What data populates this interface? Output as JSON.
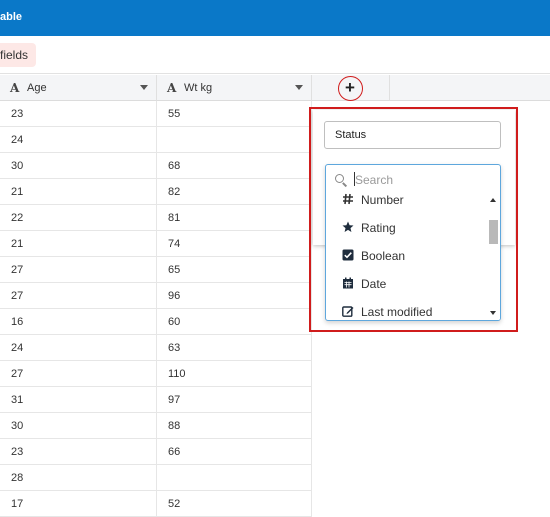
{
  "app": {
    "title": "able"
  },
  "toolbar": {
    "chip_label": "fields"
  },
  "grid": {
    "columns": [
      {
        "label": "Age",
        "type_glyph": "A"
      },
      {
        "label": "Wt kg",
        "type_glyph": "A"
      }
    ],
    "rows": [
      [
        "23",
        "55"
      ],
      [
        "24",
        ""
      ],
      [
        "30",
        "68"
      ],
      [
        "21",
        "82"
      ],
      [
        "22",
        "81"
      ],
      [
        "21",
        "74"
      ],
      [
        "27",
        "65"
      ],
      [
        "27",
        "96"
      ],
      [
        "16",
        "60"
      ],
      [
        "24",
        "63"
      ],
      [
        "27",
        "110"
      ],
      [
        "31",
        "97"
      ],
      [
        "30",
        "88"
      ],
      [
        "23",
        "66"
      ],
      [
        "28",
        ""
      ],
      [
        "17",
        "52"
      ]
    ],
    "add_column_label": "+"
  },
  "field_popup": {
    "name_value": "Status",
    "search_placeholder": "Search",
    "type_options": [
      {
        "label": "Number",
        "icon": "hash-icon"
      },
      {
        "label": "Rating",
        "icon": "star-icon"
      },
      {
        "label": "Boolean",
        "icon": "checkbox-icon"
      },
      {
        "label": "Date",
        "icon": "calendar-icon"
      },
      {
        "label": "Last modified",
        "icon": "edit-icon"
      }
    ]
  },
  "colors": {
    "topbar": "#0a78c8",
    "highlight": "#d01c1c",
    "focus": "#5ea7dd"
  }
}
